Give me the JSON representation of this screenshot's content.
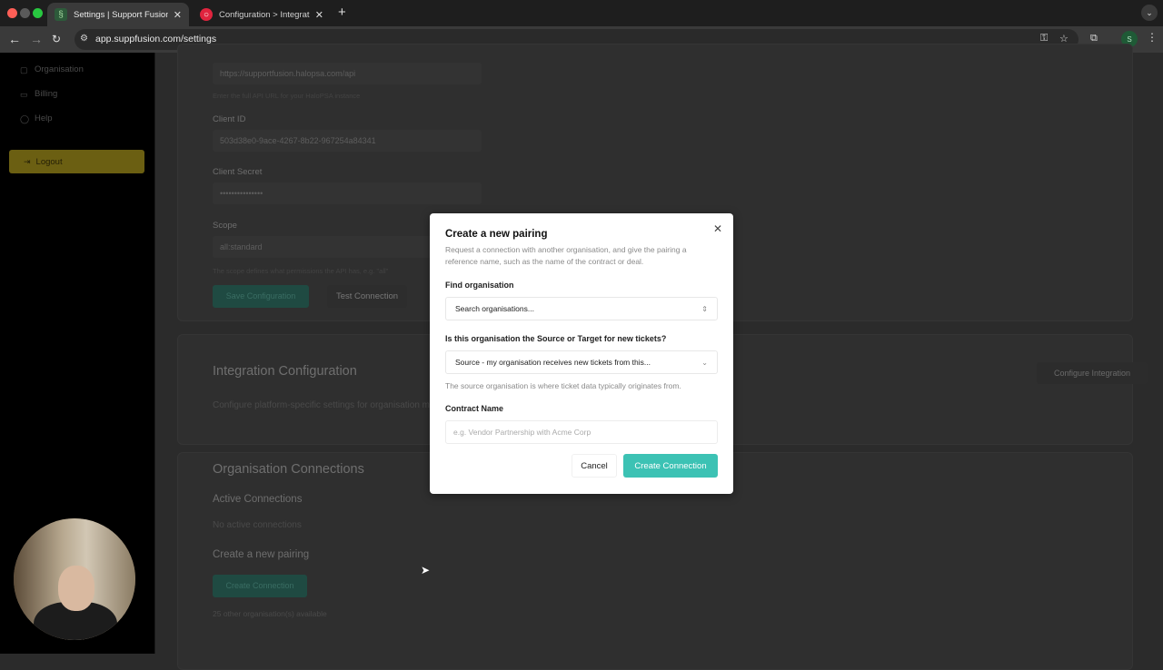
{
  "browser": {
    "tabs": [
      {
        "title": "Settings | Support Fusion",
        "active": true
      },
      {
        "title": "Configuration > Integrations",
        "active": false
      }
    ],
    "url": "app.suppfusion.com/settings",
    "profile_initial": "S"
  },
  "sidebar": {
    "items": [
      {
        "label": "Organisation",
        "icon": "building-icon"
      },
      {
        "label": "Billing",
        "icon": "card-icon"
      },
      {
        "label": "Help",
        "icon": "help-icon"
      }
    ],
    "logout_label": "Logout"
  },
  "background": {
    "api_url_value": "https://supportfusion.halopsa.com/api",
    "api_url_help": "Enter the full API URL for your HaloPSA instance",
    "client_id_label": "Client ID",
    "client_id_value": "503d38e0-9ace-4267-8b22-967254a84341",
    "client_secret_label": "Client Secret",
    "client_secret_value": "•••••••••••••••",
    "scope_label": "Scope",
    "scope_value": "all:standard",
    "scope_help": "The scope defines what permissions the API has, e.g. \"all\"",
    "save_config_label": "Save Configuration",
    "test_connection_label": "Test Connection",
    "integration_title": "Integration Configuration",
    "integration_desc": "Configure platform-specific settings for organisation m",
    "configure_integration_label": "Configure Integration",
    "org_connections_title": "Organisation Connections",
    "active_connections_title": "Active Connections",
    "no_active_text": "No active connections",
    "new_pairing_title": "Create a new pairing",
    "create_connection_label": "Create Connection",
    "orgs_available_text": "25 other organisation(s) available"
  },
  "modal": {
    "title": "Create a new pairing",
    "description": "Request a connection with another organisation, and give the pairing a reference name, such as the name of the contract or deal.",
    "find_org_label": "Find organisation",
    "find_org_placeholder": "Search organisations...",
    "role_label": "Is this organisation the Source or Target for new tickets?",
    "role_value": "Source - my organisation receives new tickets from this...",
    "role_help": "The source organisation is where ticket data typically originates from.",
    "contract_label": "Contract Name",
    "contract_placeholder": "e.g. Vendor Partnership with Acme Corp",
    "cancel_label": "Cancel",
    "create_label": "Create Connection",
    "accent_color": "#3cc2b4"
  }
}
